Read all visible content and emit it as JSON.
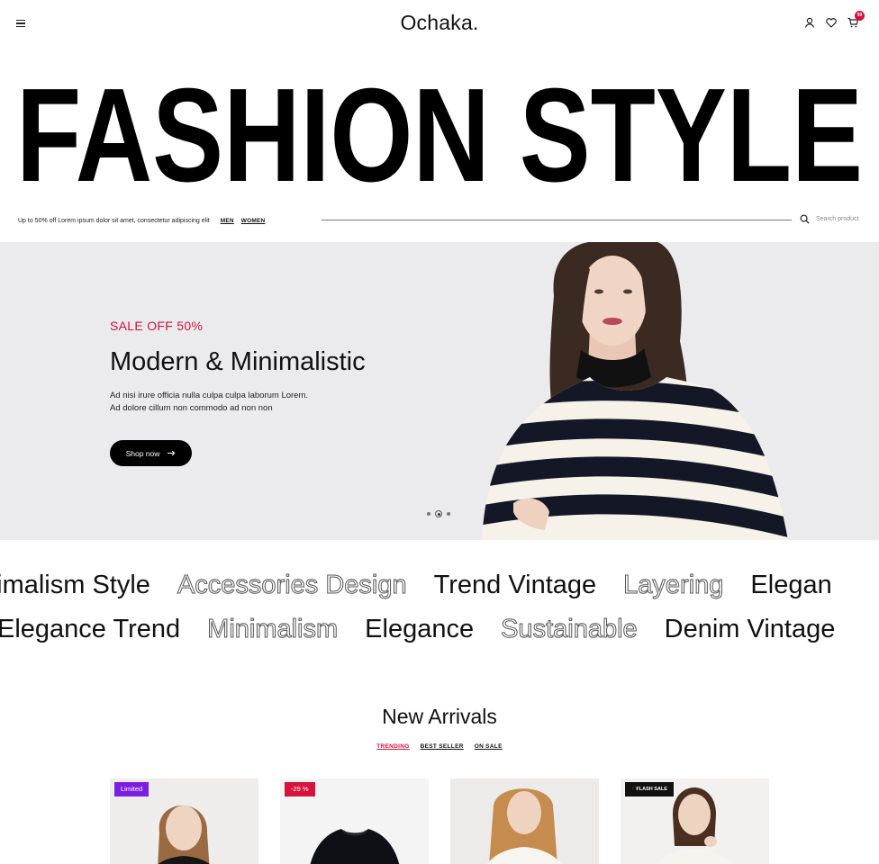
{
  "header": {
    "logo": "Ochaka.",
    "cart_count": "99",
    "icons": [
      "menu-icon",
      "user-icon",
      "heart-icon",
      "cart-icon"
    ]
  },
  "headline": "FASHION STYLE",
  "promo": {
    "text": "Up to 50% off Lorem ipsum dolor sit amet, consectetur adipiscing elit",
    "links": [
      "MEN",
      "WOMEN"
    ],
    "search_placeholder": "Search product"
  },
  "hero": {
    "sale": "SALE OFF 50%",
    "title": "Modern & Minimalistic",
    "desc_line1": "Ad nisi irure officia nulla culpa culpa laborum Lorem.",
    "desc_line2": "Ad dolore cillum non commodo ad non non",
    "button": "Shop now",
    "slides": 3,
    "active_slide": 2
  },
  "marquee": {
    "row1": [
      "nimalism Style",
      "Accessories Design",
      "Trend Vintage",
      "Layering",
      "Elegan"
    ],
    "row2": [
      "Elegance Trend",
      "Minimalism",
      "Elegance",
      "Sustainable",
      "Denim Vintage"
    ]
  },
  "new_arrivals": {
    "title": "New Arrivals",
    "tabs": [
      "TRENDING",
      "BEST SELLER",
      "ON SALE"
    ],
    "active_tab": "TRENDING"
  },
  "products": [
    {
      "badge": "Limited",
      "badge_color": "#7c1fe2"
    },
    {
      "badge": "-29 %",
      "badge_color": "#d6123d"
    },
    {
      "badge": "",
      "badge_color": ""
    },
    {
      "badge": "FLASH SALE",
      "badge_color": "#111111"
    }
  ],
  "colors": {
    "accent": "#d6123d",
    "hero_bg": "#ebebed",
    "limited": "#7c1fe2"
  }
}
